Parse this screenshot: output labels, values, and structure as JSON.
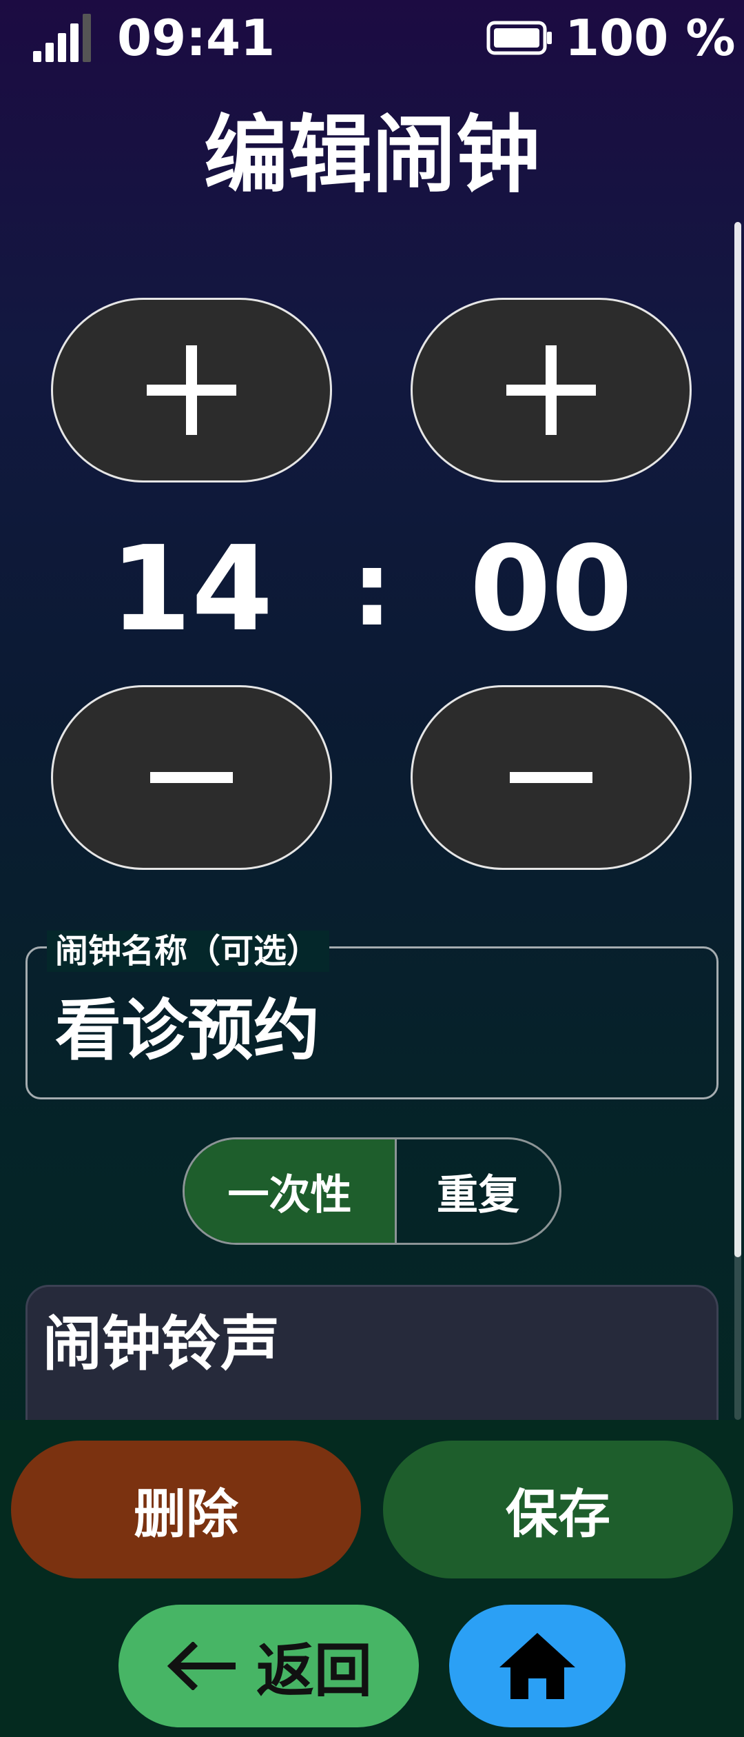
{
  "status_bar": {
    "time": "09:41",
    "battery": "100 %",
    "signal_bars": 4,
    "battery_level": 1.0
  },
  "page": {
    "title": "编辑闹钟"
  },
  "time_picker": {
    "hour": "14",
    "separator": ":",
    "minute": "00",
    "increment_icon": "plus-icon",
    "decrement_icon": "minus-icon"
  },
  "name_field": {
    "label": "闹钟名称（可选）",
    "value": "看诊预约"
  },
  "frequency": {
    "options": [
      "一次性",
      "重复"
    ],
    "selected": "一次性"
  },
  "ringtone": {
    "label": "闹钟铃声"
  },
  "actions": {
    "delete_label": "删除",
    "save_label": "保存",
    "back_label": "返回",
    "back_icon": "arrow-left-icon",
    "home_icon": "home-icon"
  },
  "colors": {
    "stepper_bg": "#2c2c2c",
    "active_segment": "#1e5e2c",
    "delete_button": "#7b3210",
    "save_button": "#1e5e2c",
    "back_button": "#47b565",
    "home_button": "#2ba0f5"
  }
}
